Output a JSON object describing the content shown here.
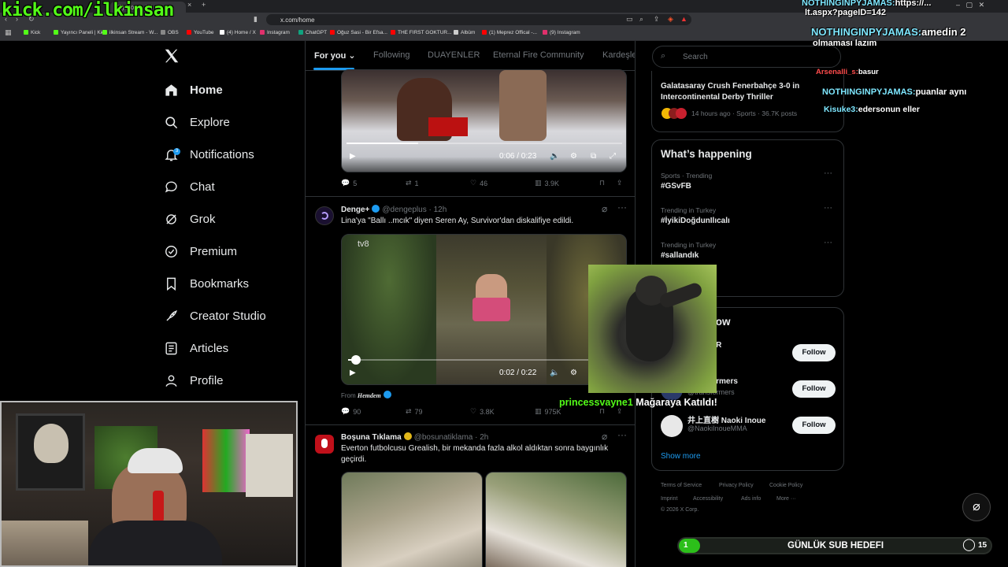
{
  "browser": {
    "tabs": [
      {
        "label": "(2) Home / X"
      }
    ],
    "url": "x.com/home",
    "bookmarks": [
      "Kick",
      "Yayıncı Paneli | Kick",
      "ilkinsan Stream - W...",
      "OBS",
      "YouTube",
      "(4) Home / X",
      "Instagram",
      "ChatGPT",
      "Oğuz Sasi - Bir Efsa...",
      "THE FIRST GOKTUR...",
      "Albüm",
      "(1) Meprez Offical -...",
      "(9) Instagram"
    ],
    "bookmark_colors": [
      "#53fc18",
      "#53fc18",
      "#53fc18",
      "#888888",
      "#ff0000",
      "#ffffff",
      "#e1306c",
      "#10a37f",
      "#ff0000",
      "#ff0000",
      "#cccccc",
      "#ff0000",
      "#e1306c"
    ]
  },
  "overlay": {
    "kick_url": "kick.com/ilkinsan",
    "chat": [
      {
        "user": "NOTHINGINPYJAMAS:",
        "text": "https://...",
        "extra": "lt.aspx?pageID=142"
      },
      {
        "user": "NOTHINGINPYJAMAS:",
        "text": "amedin 2"
      },
      {
        "user": "",
        "text": "olmaması lazım"
      },
      {
        "user": "Arsenalli_s:",
        "text": "basur"
      },
      {
        "user": "NOTHINGINPYJAMAS:",
        "text": "puanlar aynı"
      },
      {
        "user": "Kisuke3:",
        "text": "edersonun eller"
      }
    ],
    "join_user": "princessvayne1",
    "join_text": "Mağaraya Katıldı!",
    "sub_goal": {
      "label": "GÜNLÜK SUB HEDEFI",
      "current": "1",
      "target": "15",
      "progress": 0.067
    }
  },
  "sidebar": {
    "items": [
      {
        "label": "Home",
        "icon": "home-icon"
      },
      {
        "label": "Explore",
        "icon": "search-icon"
      },
      {
        "label": "Notifications",
        "icon": "bell-icon",
        "badge": "3"
      },
      {
        "label": "Chat",
        "icon": "chat-icon"
      },
      {
        "label": "Grok",
        "icon": "grok-icon"
      },
      {
        "label": "Premium",
        "icon": "premium-icon"
      },
      {
        "label": "Bookmarks",
        "icon": "bookmark-icon"
      },
      {
        "label": "Creator Studio",
        "icon": "rocket-icon"
      },
      {
        "label": "Articles",
        "icon": "articles-icon"
      },
      {
        "label": "Profile",
        "icon": "profile-icon"
      }
    ]
  },
  "feed": {
    "tabs": [
      "For you",
      "Following",
      "DUAYENLER",
      "Eternal Fire Community",
      "Kardeşle"
    ],
    "post1": {
      "video_time": "0:06 / 0:23",
      "video_progress": 0.26,
      "replies": "5",
      "reposts": "1",
      "likes": "46",
      "views": "3.9K"
    },
    "post2": {
      "name": "Denge+",
      "handle": "@dengeplus",
      "time": "12h",
      "text": "Lina'ya \"Ballı ..mcık\" diyen Seren Ay, Survivor'dan diskalifiye edildi.",
      "video_time": "0:02 / 0:22",
      "video_progress": 0.03,
      "from_label": "From",
      "from_account": "Hemdem",
      "replies": "90",
      "reposts": "79",
      "likes": "3.8K",
      "views": "975K"
    },
    "post3": {
      "name": "Boşuna Tıklama",
      "handle": "@bosunatiklama",
      "time": "2h",
      "text": "Everton futbolcusu Grealish, bir mekanda fazla alkol aldıktan sonra baygınlık geçirdi."
    }
  },
  "right": {
    "search_placeholder": "Search",
    "news": {
      "title": "Galatasaray Crush Fenerbahçe 3-0 in Intercontinental Derby Thriller",
      "meta": "14 hours ago · Sports · 36.7K posts"
    },
    "happening_title": "What’s happening",
    "trends": [
      {
        "category": "Sports · Trending",
        "name": "#GSvFB"
      },
      {
        "category": "Trending in Turkey",
        "name": "#İyikiDoğdunIlıcalı"
      },
      {
        "category": "Trending in Turkey",
        "name": "#sallandık"
      }
    ],
    "who_to_follow_title": "Who to follow",
    "follow": [
      {
        "name": "...ANLAR",
        "handle": "...anlar",
        "button": "Follow"
      },
      {
        "name": "Transformers",
        "handle": "@transformers",
        "button": "Follow"
      },
      {
        "name": "井上直樹 Naoki Inoue",
        "handle": "@NaokiInoueMMA",
        "button": "Follow"
      }
    ],
    "show_more": "Show more",
    "footer": [
      "Terms of Service",
      "Privacy Policy",
      "Cookie Policy",
      "Imprint",
      "Accessibility",
      "Ads info",
      "More ···"
    ],
    "copyright": "© 2026 X Corp."
  }
}
